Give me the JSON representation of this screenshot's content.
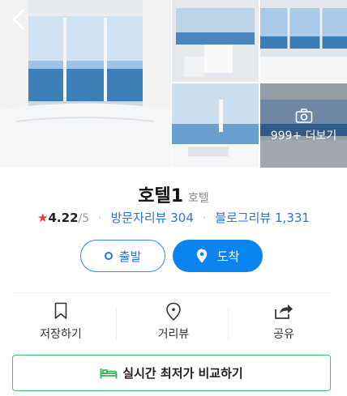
{
  "gallery": {
    "more_label": "999+ 더보기"
  },
  "hotel": {
    "name": "호텔1",
    "category": "호텔",
    "rating_star": "★",
    "rating": "4.22",
    "rating_max": "/5",
    "visitor_reviews": "방문자리뷰 304",
    "blog_reviews": "블로그리뷰 1,331"
  },
  "route": {
    "departure_label": "출발",
    "arrival_label": "도착"
  },
  "actions": {
    "save_label": "저장하기",
    "street_view_label": "거리뷰",
    "share_label": "공유"
  },
  "compare": {
    "label": "실시간 최저가 비교하기"
  },
  "colors": {
    "accent_blue": "#0b84f0",
    "link_blue": "#2a73d9",
    "star_red": "#e83b3b",
    "compare_green": "#3cc56a"
  }
}
